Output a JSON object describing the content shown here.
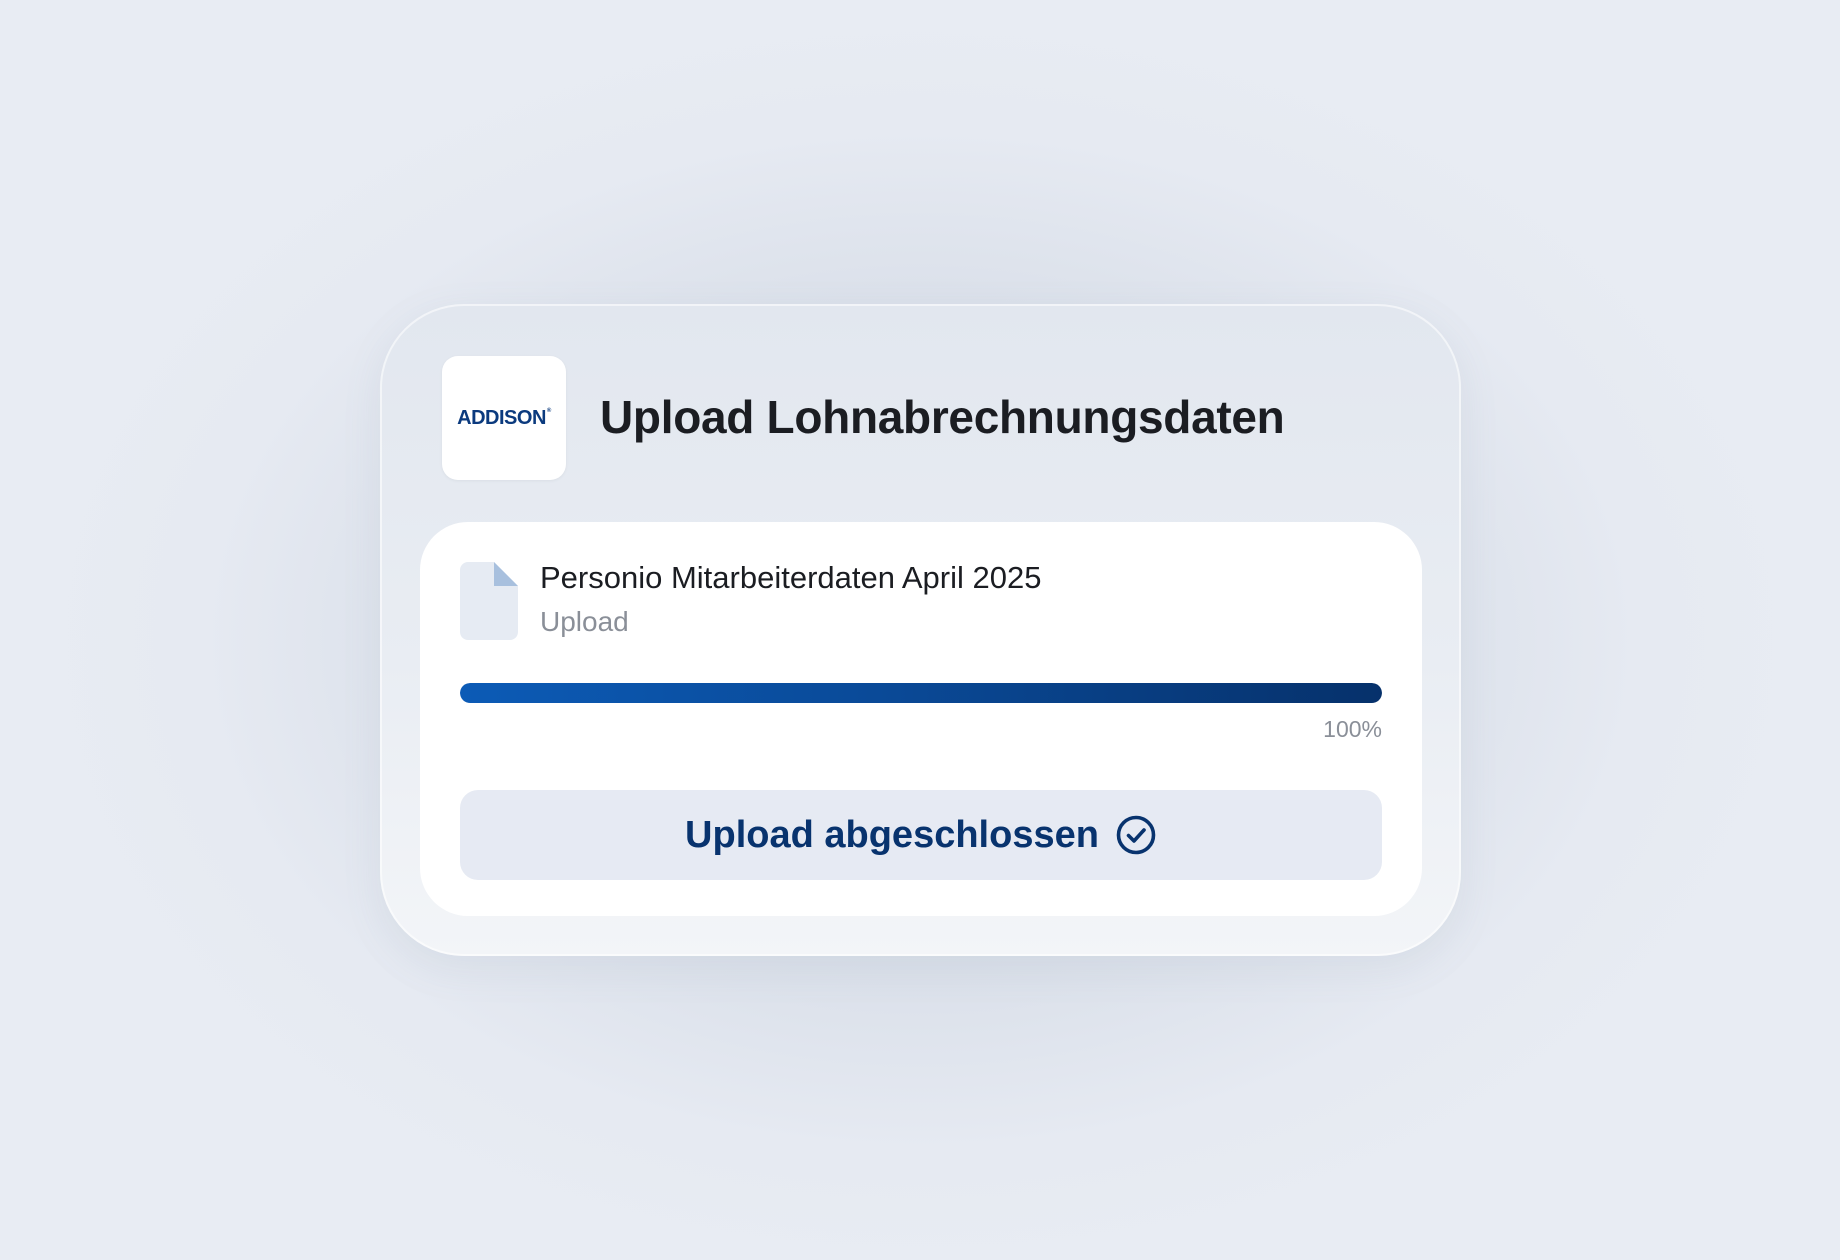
{
  "header": {
    "logo_text": "ADDISON",
    "logo_mark": "®",
    "title": "Upload Lohnabrechnungsdaten"
  },
  "file": {
    "icon": "file-icon",
    "name": "Personio Mitarbeiterdaten April 2025",
    "status": "Upload"
  },
  "progress": {
    "value": 1.0,
    "label": "100%"
  },
  "action": {
    "label": "Upload abgeschlossen",
    "icon": "check-circle-icon"
  },
  "colors": {
    "brand": "#0b3a7e",
    "progress_start": "#0c5bb6",
    "progress_end": "#06316b",
    "button_bg": "#e6eaf3"
  }
}
